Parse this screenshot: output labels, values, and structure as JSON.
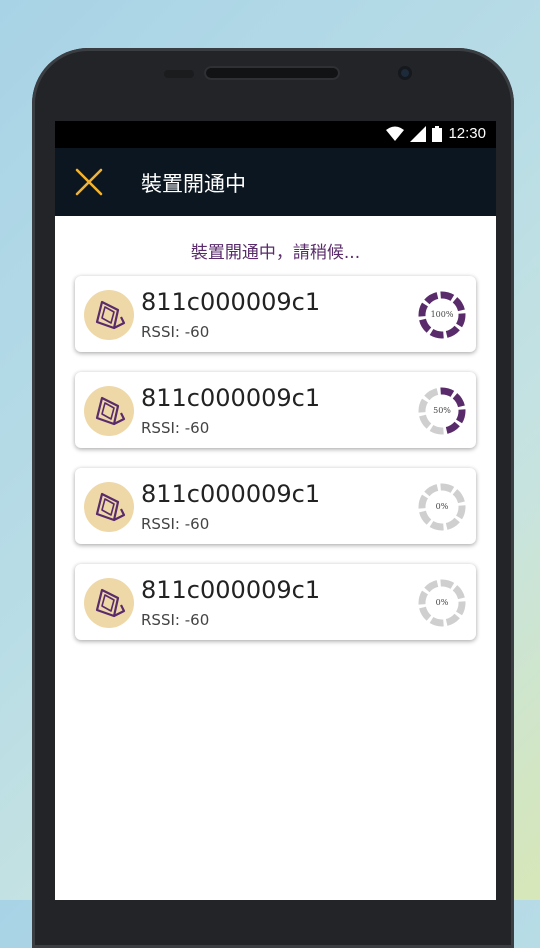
{
  "status_bar": {
    "time": "12:30"
  },
  "app_bar": {
    "title": "裝置開通中",
    "close_icon": "close-icon"
  },
  "subtitle": "裝置開通中，請稍候...",
  "devices": [
    {
      "id": "811c000009c1",
      "rssi_label": "RSSI:",
      "rssi_value": "-60",
      "progress": 1.0,
      "progress_label": "100%"
    },
    {
      "id": "811c000009c1",
      "rssi_label": "RSSI:",
      "rssi_value": "-60",
      "progress": 0.5,
      "progress_label": "50%"
    },
    {
      "id": "811c000009c1",
      "rssi_label": "RSSI:",
      "rssi_value": "-60",
      "progress": 0.0,
      "progress_label": "0%"
    },
    {
      "id": "811c000009c1",
      "rssi_label": "RSSI:",
      "rssi_value": "-60",
      "progress": 0.0,
      "progress_label": "0%"
    }
  ],
  "colors": {
    "accent": "#5a2b6b",
    "icon_bg": "#eed8a8",
    "close": "#f2b233",
    "appbar": "#0b1620"
  }
}
